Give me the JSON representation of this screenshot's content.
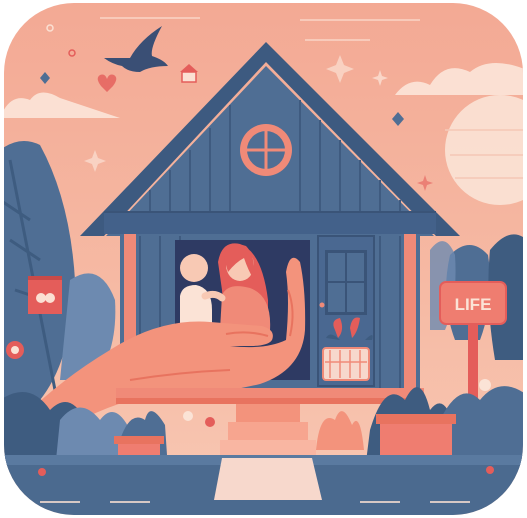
{
  "sign": {
    "text": "LIFE"
  },
  "colors": {
    "sky": "#f4b39c",
    "sky_light": "#f9cdb8",
    "sun": "#fbe3d6",
    "house_wall": "#4f6e94",
    "house_wall_dark": "#3f5b80",
    "roof": "#3d5a80",
    "trim": "#f08a78",
    "hand": "#f3937c",
    "plant_dark": "#3e5c80",
    "plant_mid": "#6d8ab0",
    "ground": "#4b6a8f",
    "path": "#f7d8cc",
    "accent_red": "#e45d5a",
    "sign_board": "#ef7d70"
  },
  "icons": [
    "bird-icon",
    "heart-icon",
    "sparkle-icon",
    "round-window-icon",
    "flower-icon"
  ]
}
